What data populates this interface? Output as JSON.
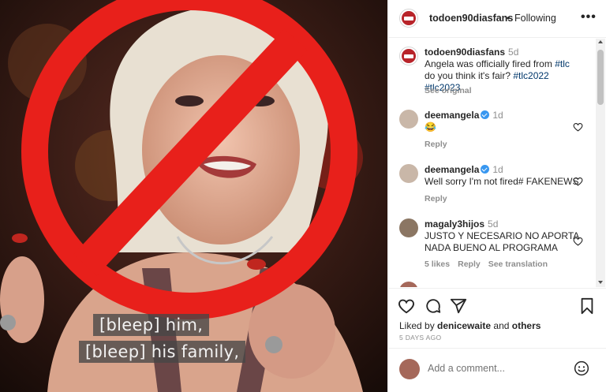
{
  "header": {
    "username": "todoen90diasfans",
    "separator": "•",
    "follow_status": "Following",
    "more_icon": "more-horizontal-icon"
  },
  "media": {
    "caption_line1": "[bleep] him,",
    "caption_line2": "[bleep] his family,",
    "prohibition_color": "#e8201b"
  },
  "post": {
    "username": "todoen90diasfans",
    "time": "5d",
    "text_before": "Angela was officially fired from ",
    "tag1": "#tlc",
    "text_mid": " do you think it's fair? ",
    "tag2": "#tlc2022",
    "tag3": "#tlc2023",
    "see_original": "See original"
  },
  "comments": [
    {
      "username": "deemangela",
      "verified": true,
      "time": "1d",
      "text": "😂",
      "reply": "Reply"
    },
    {
      "username": "deemangela",
      "verified": true,
      "time": "1d",
      "text": "Well sorry I'm not fired# FAKENEWS",
      "reply": "Reply"
    },
    {
      "username": "magaly3hijos",
      "verified": false,
      "time": "5d",
      "text": "JUSTO Y NECESARIO NO APORTA NADA BUENO AL PROGRAMA",
      "likes": "5 likes",
      "reply": "Reply",
      "translate": "See translation"
    }
  ],
  "actions": {
    "like_icon": "heart-icon",
    "comment_icon": "comment-icon",
    "share_icon": "share-icon",
    "save_icon": "bookmark-icon",
    "liked_by_prefix": "Liked by ",
    "liked_by_user": "denicewaite",
    "liked_by_and": " and ",
    "liked_by_others": "others",
    "date": "5 DAYS AGO"
  },
  "composer": {
    "placeholder": "Add a comment...",
    "emoji_icon": "emoji-icon"
  },
  "colors": {
    "link": "#00376b",
    "muted": "#8e8e8e",
    "verified": "#3897f0"
  }
}
